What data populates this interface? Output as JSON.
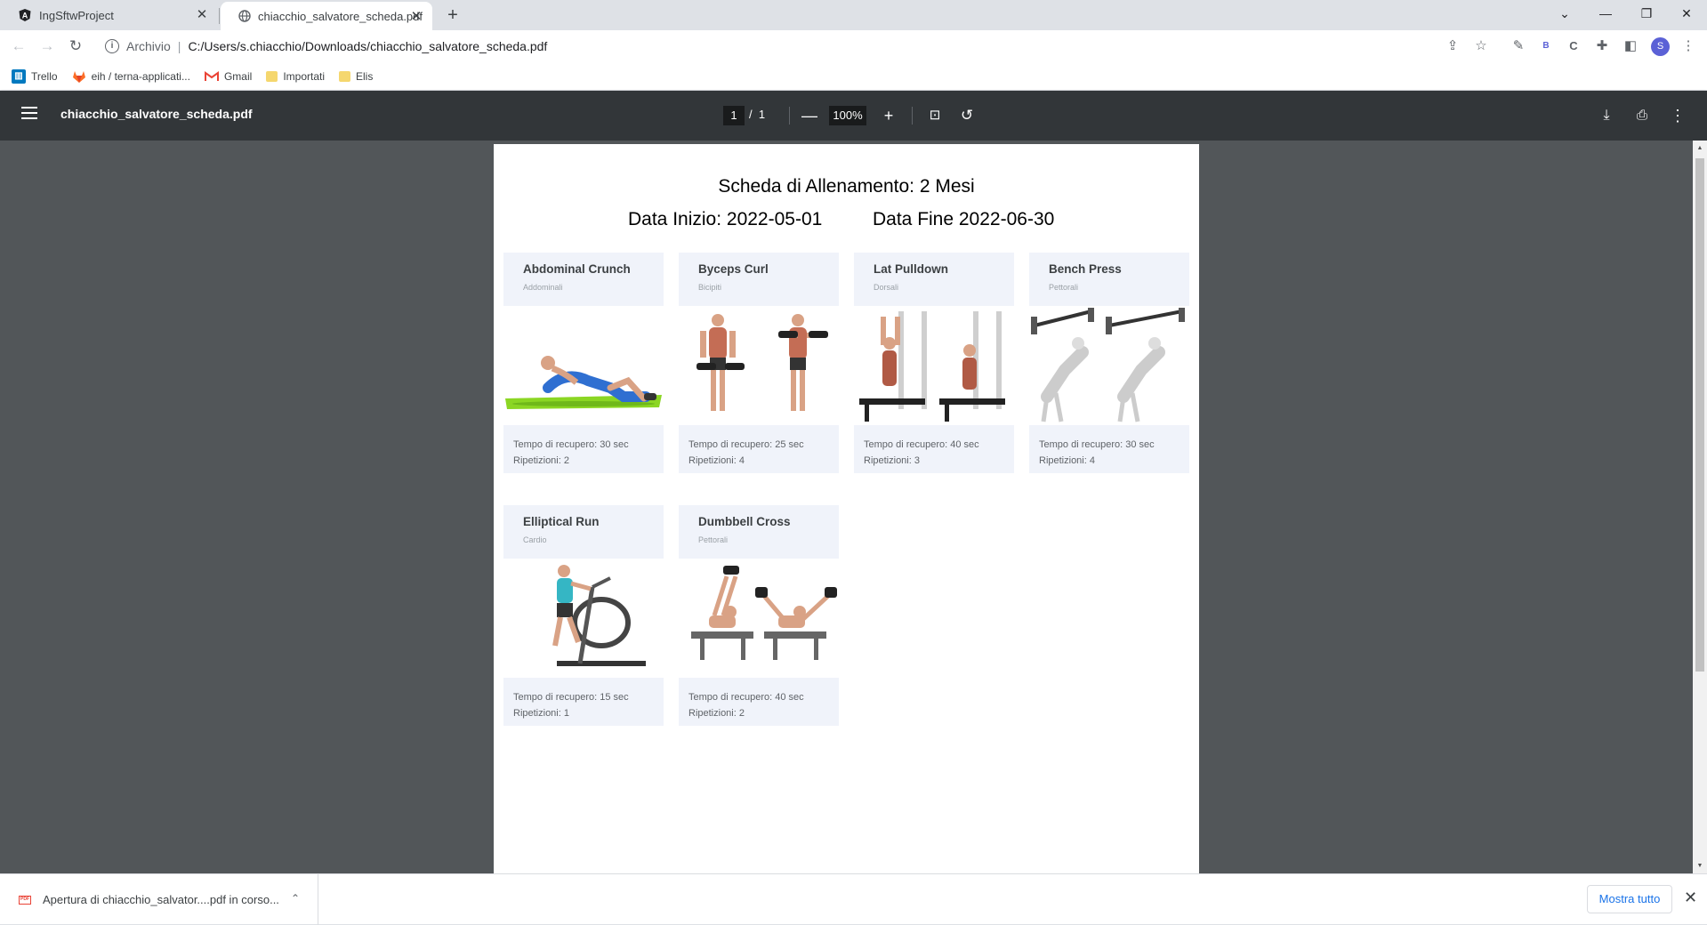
{
  "browser": {
    "tabs": [
      {
        "title": "IngSftwProject",
        "icon": "angular-icon"
      },
      {
        "title": "chiacchio_salvatore_scheda.pdf",
        "icon": "globe-icon"
      }
    ],
    "omnibox": {
      "label": "Archivio",
      "url": "C:/Users/s.chiacchio/Downloads/chiacchio_salvatore_scheda.pdf"
    },
    "profile_initial": "S",
    "bookmarks": [
      {
        "label": "Trello",
        "icon": "trello-icon"
      },
      {
        "label": "eih / terna-applicati...",
        "icon": "gitlab-icon"
      },
      {
        "label": "Gmail",
        "icon": "gmail-icon"
      },
      {
        "label": "Importati",
        "icon": "folder-icon"
      },
      {
        "label": "Elis",
        "icon": "folder-icon"
      }
    ]
  },
  "pdf_viewer": {
    "filename": "chiacchio_salvatore_scheda.pdf",
    "current_page": "1",
    "page_sep": "/",
    "total_pages": "1",
    "zoom": "100%"
  },
  "document": {
    "title": "Scheda di Allenamento: 2 Mesi",
    "start": "Data Inizio: 2022-05-01",
    "end": "Data Fine 2022-06-30",
    "exercises": [
      {
        "name": "Abdominal Crunch",
        "muscle": "Addominali",
        "rest": "Tempo di recupero: 30 sec",
        "reps": "Ripetizioni: 2"
      },
      {
        "name": "Byceps Curl",
        "muscle": "Bicipiti",
        "rest": "Tempo di recupero: 25 sec",
        "reps": "Ripetizioni: 4"
      },
      {
        "name": "Lat Pulldown",
        "muscle": "Dorsali",
        "rest": "Tempo di recupero: 40 sec",
        "reps": "Ripetizioni: 3"
      },
      {
        "name": "Bench Press",
        "muscle": "Pettorali",
        "rest": "Tempo di recupero: 30 sec",
        "reps": "Ripetizioni: 4"
      },
      {
        "name": "Elliptical Run",
        "muscle": "Cardio",
        "rest": "Tempo di recupero: 15 sec",
        "reps": "Ripetizioni: 1"
      },
      {
        "name": "Dumbbell Cross",
        "muscle": "Pettorali",
        "rest": "Tempo di recupero: 40 sec",
        "reps": "Ripetizioni: 2"
      }
    ]
  },
  "downloads": {
    "item": "Apertura di chiacchio_salvator....pdf in corso...",
    "show_all": "Mostra tutto"
  }
}
